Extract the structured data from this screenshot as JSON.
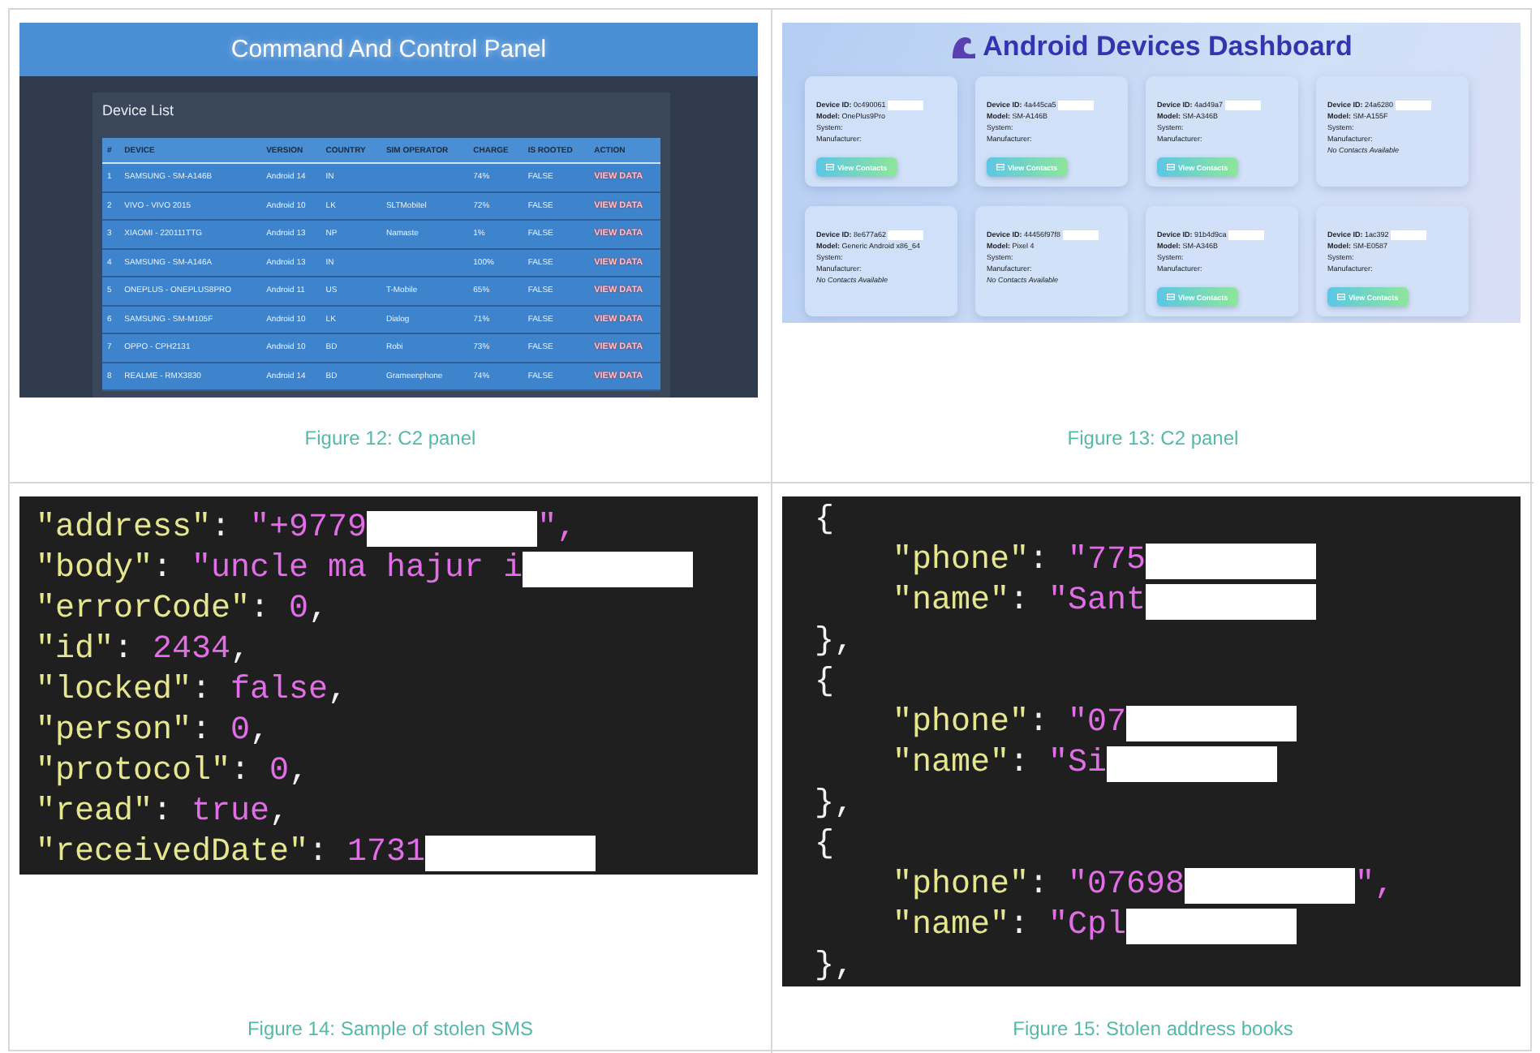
{
  "figures": [
    {
      "kind": "c2-panel",
      "caption": "Figure 12: C2 panel",
      "title": "Command And Control Panel",
      "panel_title": "Device List",
      "columns": [
        "#",
        "DEVICE",
        "VERSION",
        "COUNTRY",
        "SIM OPERATOR",
        "CHARGE",
        "IS ROOTED",
        "ACTION"
      ],
      "rows": [
        {
          "n": "1",
          "device": "SAMSUNG - SM-A146B",
          "version": "Android 14",
          "country": "IN",
          "charge": "74%",
          "rooted": "FALSE",
          "action": "VIEW DATA"
        },
        {
          "n": "2",
          "device": "VIVO - VIVO 2015",
          "version": "Android 10",
          "country": "LK",
          "sim_operator": "SLTMobitel",
          "charge": "72%",
          "rooted": "FALSE",
          "action": "VIEW DATA"
        },
        {
          "n": "3",
          "device": "XIAOMI - 220111TTG",
          "version": "Android 13",
          "country": "NP",
          "sim_operator": "Namaste",
          "charge": "1%",
          "rooted": "FALSE",
          "action": "VIEW DATA"
        },
        {
          "n": "4",
          "device": "SAMSUNG - SM-A146A",
          "version": "Android 13",
          "country": "IN",
          "charge": "100%",
          "rooted": "FALSE",
          "action": "VIEW DATA"
        },
        {
          "n": "5",
          "device": "ONEPLUS - ONEPLUS8PRO",
          "version": "Android 11",
          "country": "US",
          "sim_operator": "T-Mobile",
          "charge": "65%",
          "rooted": "FALSE",
          "action": "VIEW DATA"
        },
        {
          "n": "6",
          "device": "SAMSUNG - SM-M105F",
          "version": "Android 10",
          "country": "LK",
          "sim_operator": "Dialog",
          "charge": "71%",
          "rooted": "FALSE",
          "action": "VIEW DATA"
        },
        {
          "n": "7",
          "device": "OPPO - CPH2131",
          "version": "Android 10",
          "country": "BD",
          "sim_operator": "Robi",
          "charge": "73%",
          "rooted": "FALSE",
          "action": "VIEW DATA"
        },
        {
          "n": "8",
          "device": "REALME - RMX3830",
          "version": "Android 14",
          "country": "BD",
          "sim_operator": "Grameenphone",
          "charge": "74%",
          "rooted": "FALSE",
          "action": "VIEW DATA"
        }
      ]
    },
    {
      "kind": "dashboard",
      "caption": "Figure 13: C2 panel",
      "title": "Android Devices Dashboard",
      "cards": [
        {
          "device_id": "**Device ID:** 0c490061",
          "model": "**Model:** OnePlus9Pro",
          "system": "System:",
          "manufacturer": "Manufacturer:",
          "contacts": {
            "kind": "button",
            "text": "View Contacts"
          }
        },
        {
          "device_id": "**Device ID:** 4a445ca5",
          "model": "**Model:** SM-A146B",
          "system": "System:",
          "manufacturer": "Manufacturer:",
          "contacts": {
            "kind": "button",
            "text": "View Contacts"
          }
        },
        {
          "device_id": "**Device ID:** 4ad49a7",
          "model": "**Model:** SM-A346B",
          "system": "System:",
          "manufacturer": "Manufacturer:",
          "contacts": {
            "kind": "button",
            "text": "View Contacts"
          }
        },
        {
          "device_id": "**Device ID:** 24a6280",
          "model": "**Model:** SM-A155F",
          "system": "System:",
          "manufacturer": "Manufacturer:",
          "contacts": {
            "kind": "note",
            "text": "No Contacts Available"
          }
        },
        {
          "device_id": "**Device ID:** 8e677a62",
          "model": "**Model:** Generic Android x86_64",
          "system": "System:",
          "manufacturer": "Manufacturer:",
          "contacts": {
            "kind": "note",
            "text": "No Contacts Available"
          }
        },
        {
          "device_id": "**Device ID:** 44456f97f8",
          "model": "**Model:** Pixel 4",
          "system": "System:",
          "manufacturer": "Manufacturer:",
          "contacts": {
            "kind": "note",
            "text": "No Contacts Available"
          }
        },
        {
          "device_id": "**Device ID:** 91b4d9ca",
          "model": "**Model:** SM-A346B",
          "system": "System:",
          "manufacturer": "Manufacturer:",
          "contacts": {
            "kind": "button",
            "text": "View Contacts"
          }
        },
        {
          "device_id": "**Device ID:** 1ac392",
          "model": "**Model:** SM-E0587",
          "system": "System:",
          "manufacturer": "Manufacturer:",
          "contacts": {
            "kind": "button",
            "text": "View Contacts"
          }
        }
      ]
    },
    {
      "kind": "code",
      "caption": "Figure 14: Sample of stolen SMS",
      "lines": [
        {
          "indented": false,
          "segments": [
            {
              "kind": "key",
              "text": "\"address\""
            },
            {
              "kind": "punct",
              "text": ": "
            },
            {
              "kind": "value",
              "text": "\"+9779"
            },
            {
              "kind": "redaction"
            },
            {
              "kind": "value",
              "text": "\","
            }
          ]
        },
        {
          "indented": false,
          "segments": [
            {
              "kind": "key",
              "text": "\"body\""
            },
            {
              "kind": "punct",
              "text": ": "
            },
            {
              "kind": "value",
              "text": "\"uncle ma hajur i"
            },
            {
              "kind": "redaction"
            }
          ]
        },
        {
          "indented": false,
          "segments": [
            {
              "kind": "key",
              "text": "\"errorCode\""
            },
            {
              "kind": "punct",
              "text": ": "
            },
            {
              "kind": "value",
              "text": "0"
            },
            {
              "kind": "punct",
              "text": ","
            }
          ]
        },
        {
          "indented": false,
          "segments": [
            {
              "kind": "key",
              "text": "\"id\""
            },
            {
              "kind": "punct",
              "text": ": "
            },
            {
              "kind": "value",
              "text": "2434"
            },
            {
              "kind": "punct",
              "text": ","
            }
          ]
        },
        {
          "indented": false,
          "segments": [
            {
              "kind": "key",
              "text": "\"locked\""
            },
            {
              "kind": "punct",
              "text": ": "
            },
            {
              "kind": "value",
              "text": "false"
            },
            {
              "kind": "punct",
              "text": ","
            }
          ]
        },
        {
          "indented": false,
          "segments": [
            {
              "kind": "key",
              "text": "\"person\""
            },
            {
              "kind": "punct",
              "text": ": "
            },
            {
              "kind": "value",
              "text": "0"
            },
            {
              "kind": "punct",
              "text": ","
            }
          ]
        },
        {
          "indented": false,
          "segments": [
            {
              "kind": "key",
              "text": "\"protocol\""
            },
            {
              "kind": "punct",
              "text": ": "
            },
            {
              "kind": "value",
              "text": "0"
            },
            {
              "kind": "punct",
              "text": ","
            }
          ]
        },
        {
          "indented": false,
          "segments": [
            {
              "kind": "key",
              "text": "\"read\""
            },
            {
              "kind": "punct",
              "text": ": "
            },
            {
              "kind": "value",
              "text": "true"
            },
            {
              "kind": "punct",
              "text": ","
            }
          ]
        },
        {
          "indented": false,
          "segments": [
            {
              "kind": "key",
              "text": "\"receivedDate\""
            },
            {
              "kind": "punct",
              "text": ": "
            },
            {
              "kind": "value",
              "text": "1731"
            },
            {
              "kind": "redaction"
            }
          ]
        }
      ]
    },
    {
      "kind": "code",
      "caption": "Figure 15: Stolen address books",
      "lines": [
        {
          "indented": false,
          "segments": [
            {
              "kind": "punct",
              "text": "{"
            }
          ]
        },
        {
          "indented": true,
          "segments": [
            {
              "kind": "key",
              "text": "\"phone\""
            },
            {
              "kind": "punct",
              "text": ": "
            },
            {
              "kind": "value",
              "text": "\"775"
            },
            {
              "kind": "redaction"
            }
          ]
        },
        {
          "indented": true,
          "segments": [
            {
              "kind": "key",
              "text": "\"name\""
            },
            {
              "kind": "punct",
              "text": ": "
            },
            {
              "kind": "value",
              "text": "\"Sant"
            },
            {
              "kind": "redaction"
            }
          ]
        },
        {
          "indented": false,
          "segments": [
            {
              "kind": "punct",
              "text": "},"
            }
          ]
        },
        {
          "indented": false,
          "segments": [
            {
              "kind": "punct",
              "text": "{"
            }
          ]
        },
        {
          "indented": true,
          "segments": [
            {
              "kind": "key",
              "text": "\"phone\""
            },
            {
              "kind": "punct",
              "text": ": "
            },
            {
              "kind": "value",
              "text": "\"07"
            },
            {
              "kind": "redaction"
            }
          ]
        },
        {
          "indented": true,
          "segments": [
            {
              "kind": "key",
              "text": "\"name\""
            },
            {
              "kind": "punct",
              "text": ": "
            },
            {
              "kind": "value",
              "text": "\"Si"
            },
            {
              "kind": "redaction"
            }
          ]
        },
        {
          "indented": false,
          "segments": [
            {
              "kind": "punct",
              "text": "},"
            }
          ]
        },
        {
          "indented": false,
          "segments": [
            {
              "kind": "punct",
              "text": "{"
            }
          ]
        },
        {
          "indented": true,
          "segments": [
            {
              "kind": "key",
              "text": "\"phone\""
            },
            {
              "kind": "punct",
              "text": ": "
            },
            {
              "kind": "value",
              "text": "\"07698"
            },
            {
              "kind": "redaction"
            },
            {
              "kind": "value",
              "text": "\","
            }
          ]
        },
        {
          "indented": true,
          "segments": [
            {
              "kind": "key",
              "text": "\"name\""
            },
            {
              "kind": "punct",
              "text": ": "
            },
            {
              "kind": "value",
              "text": "\"Cpl"
            },
            {
              "kind": "redaction"
            }
          ]
        },
        {
          "indented": false,
          "segments": [
            {
              "kind": "punct",
              "text": "},"
            }
          ]
        }
      ]
    }
  ]
}
